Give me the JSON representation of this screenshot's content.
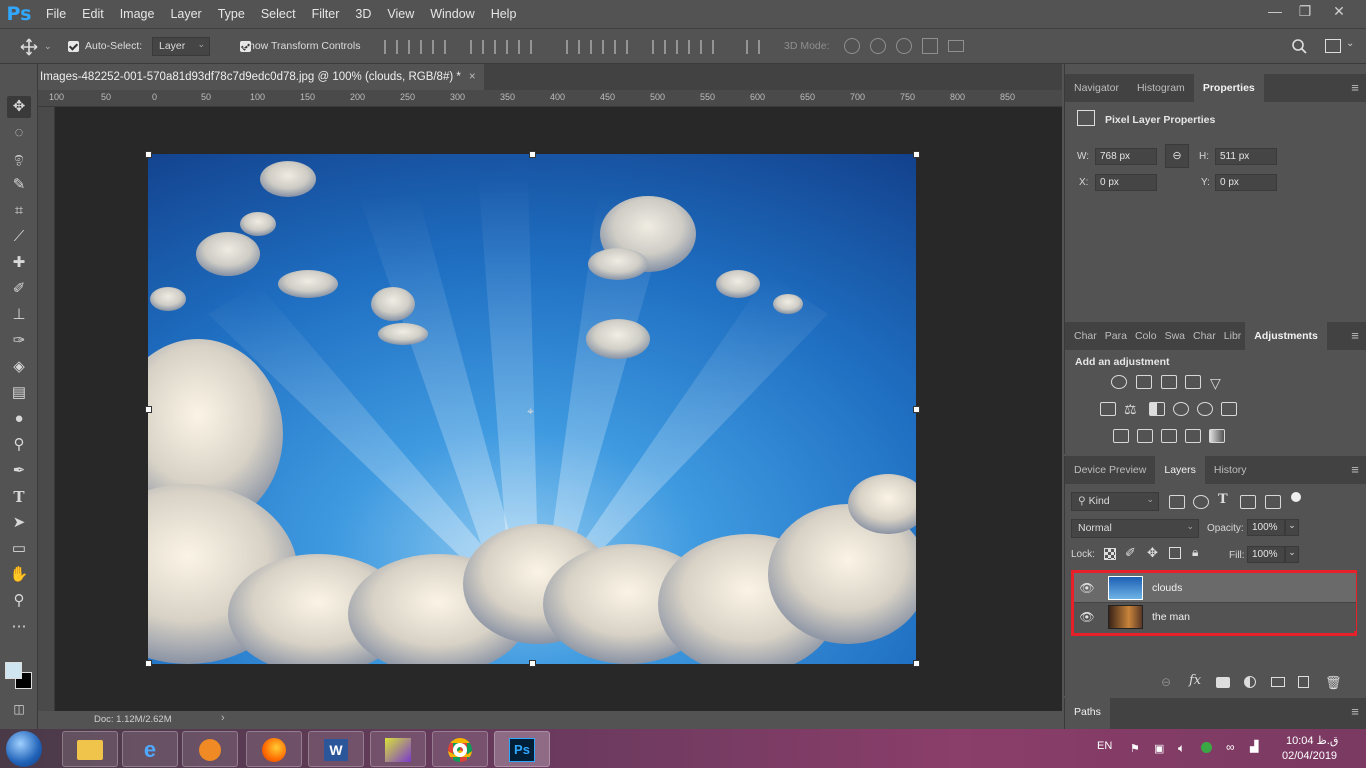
{
  "app": {
    "logo": "Ps"
  },
  "menu": [
    "File",
    "Edit",
    "Image",
    "Layer",
    "Type",
    "Select",
    "Filter",
    "3D",
    "View",
    "Window",
    "Help"
  ],
  "window_controls": [
    "—",
    "❐",
    "✕"
  ],
  "options": {
    "auto_select_label": "Auto-Select:",
    "auto_select_value": "Layer",
    "show_transform_label": "Show Transform Controls",
    "mode_3d_label": "3D Mode:"
  },
  "document": {
    "tab_title": "Images-482252-001-570a81d93df78c7d9edc0d78.jpg @ 100% (clouds, RGB/8#) *",
    "close": "×",
    "status": "Doc: 1.12M/2.62M",
    "status_arrow": "›"
  },
  "ruler": [
    "100",
    "50",
    "0",
    "50",
    "100",
    "150",
    "200",
    "250",
    "300",
    "350",
    "400",
    "450",
    "500",
    "550",
    "600",
    "650",
    "700",
    "750",
    "800",
    "850"
  ],
  "properties_panel": {
    "tabs": [
      "Navigator",
      "Histogram",
      "Properties"
    ],
    "title": "Pixel Layer Properties",
    "w_label": "W:",
    "w_value": "768 px",
    "h_label": "H:",
    "h_value": "511 px",
    "x_label": "X:",
    "x_value": "0 px",
    "y_label": "Y:",
    "y_value": "0 px"
  },
  "adjustments_panel": {
    "tabs": [
      "Char",
      "Para",
      "Colo",
      "Swa",
      "Char",
      "Libr",
      "Adjustments"
    ],
    "title": "Add an adjustment"
  },
  "layers_panel": {
    "tabs": [
      "Device Preview",
      "Layers",
      "History"
    ],
    "filter_kind": "Kind",
    "blend_mode": "Normal",
    "opacity_label": "Opacity:",
    "opacity_value": "100%",
    "lock_label": "Lock:",
    "fill_label": "Fill:",
    "fill_value": "100%",
    "layers": [
      {
        "name": "clouds",
        "selected": true
      },
      {
        "name": "the man",
        "selected": false
      }
    ]
  },
  "paths_panel": {
    "tab": "Paths"
  },
  "taskbar": {
    "lang": "EN",
    "time": "10:04 ق.ظ",
    "date": "02/04/2019"
  },
  "colors": {
    "highlight_box": "#e8202a",
    "ps_blue": "#31a8ff",
    "sky_top": "#1b5fb0",
    "sky_mid": "#2f8fd8"
  }
}
